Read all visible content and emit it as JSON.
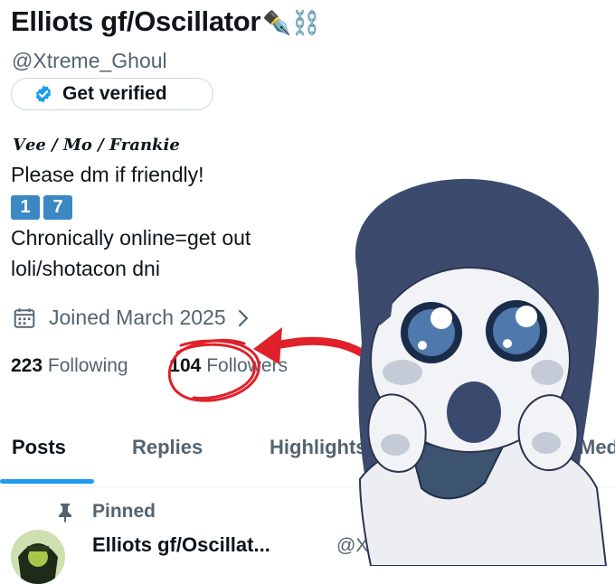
{
  "profile": {
    "display_name": "Elliots gf/Oscillator",
    "name_emoji": "✒️⛓️",
    "handle": "@Xtreme_Ghoul",
    "verify_label": "Get verified",
    "bio_signature": "𝑽𝒆𝒆 / 𝑴𝒐 / 𝑭𝒓𝒂𝒏𝒌𝒊𝒆",
    "bio_line1": "Please dm if friendly!",
    "bio_keycaps": [
      "1",
      "7"
    ],
    "bio_line2": "Chronically online=get out",
    "bio_line3": "loli/shotacon dni",
    "joined": "Joined March 2025",
    "following_count": "223",
    "following_label": "Following",
    "followers_count": "104",
    "followers_label": "Followers"
  },
  "tabs": [
    {
      "label": "Posts",
      "active": true
    },
    {
      "label": "Replies",
      "active": false
    },
    {
      "label": "Highlights",
      "active": false
    },
    {
      "label": "Media",
      "active": false
    }
  ],
  "pinned_post": {
    "pinned_label": "Pinned",
    "author_name": "Elliots gf/Oscillat...",
    "author_handle": "@X"
  },
  "colors": {
    "accent": "#1d9bf0",
    "annotation_red": "#e0202a",
    "character_hair": "#3c4a6e"
  }
}
